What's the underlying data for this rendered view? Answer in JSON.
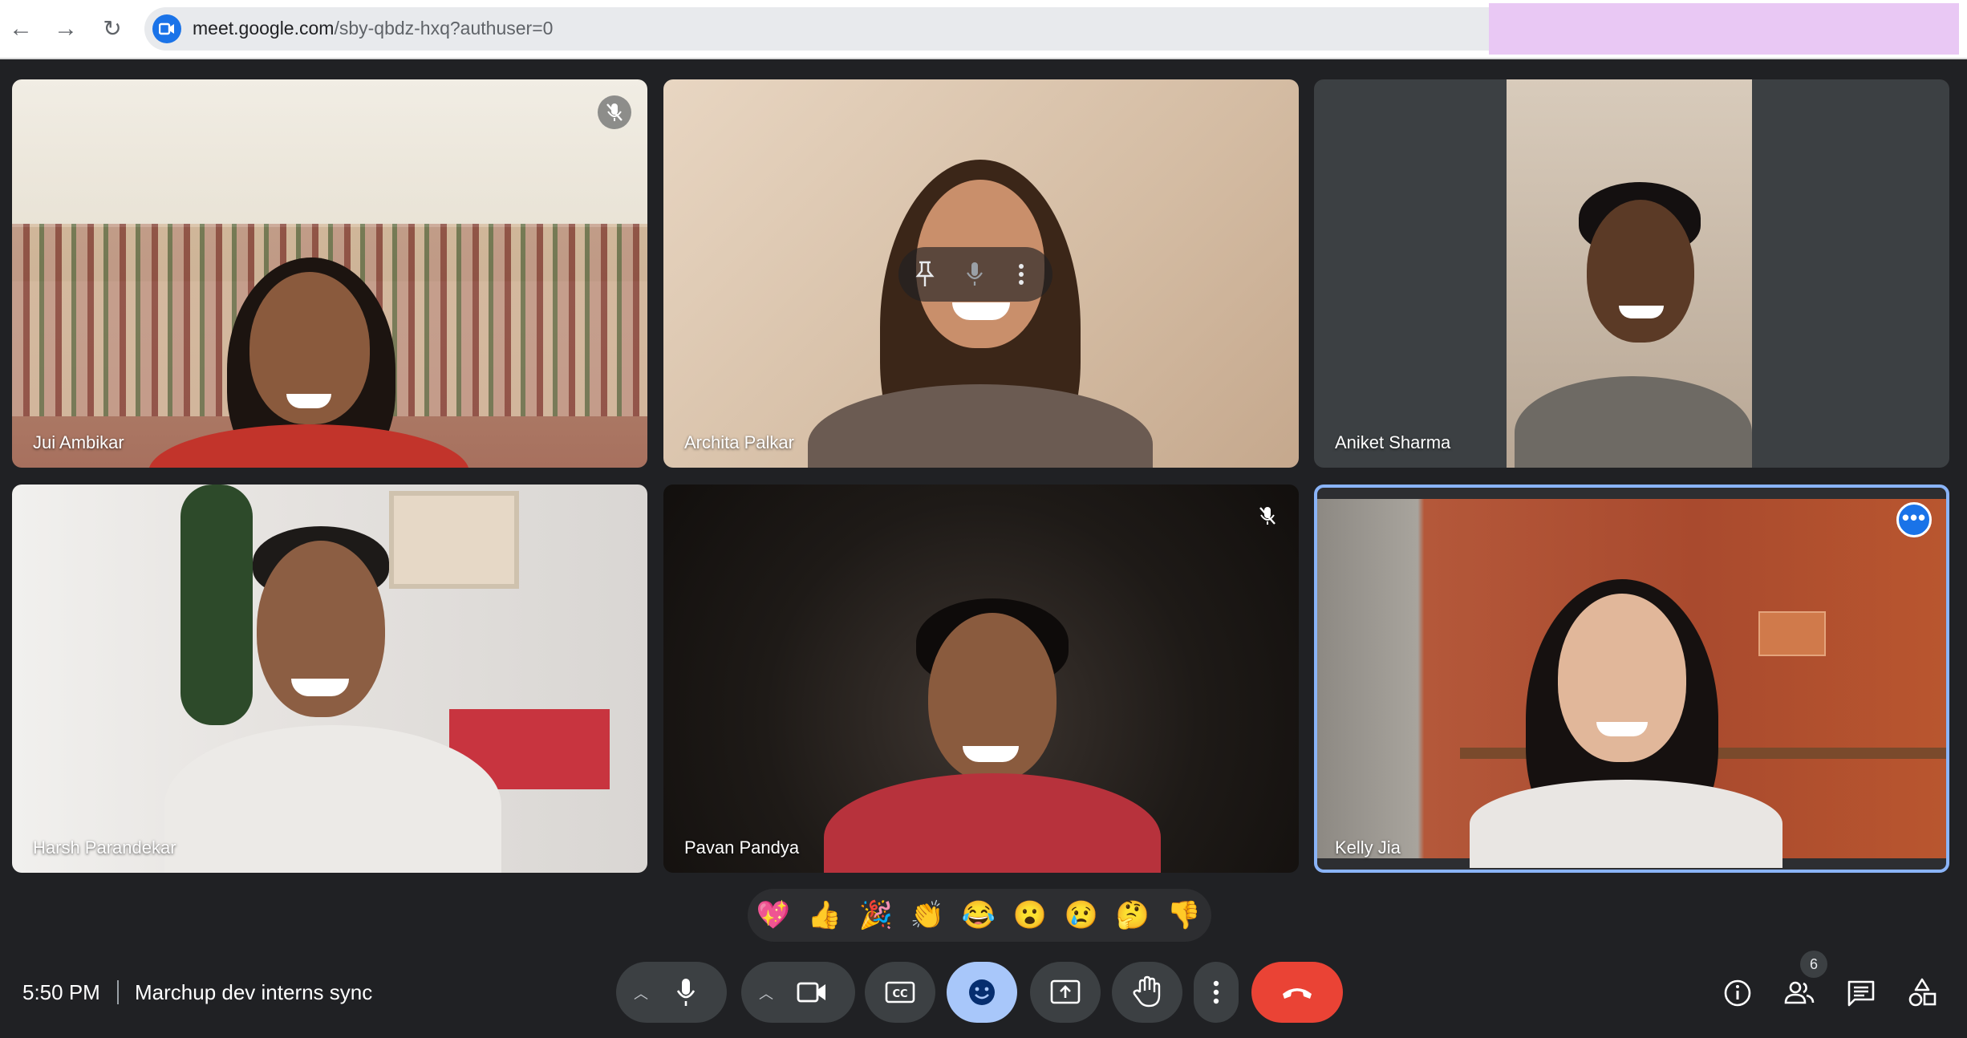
{
  "browser": {
    "url_host": "meet.google.com",
    "url_path": "/sby-qbdz-hxq?authuser=0"
  },
  "participants": [
    {
      "name": "Jui Ambikar",
      "muted": true
    },
    {
      "name": "Archita Palkar",
      "muted": false
    },
    {
      "name": "Aniket Sharma",
      "muted": false
    },
    {
      "name": "Harsh Parandekar",
      "muted": false
    },
    {
      "name": "Pavan Pandya",
      "muted": true
    },
    {
      "name": "Kelly Jia",
      "muted": false,
      "selected": true
    }
  ],
  "reactions": [
    "💖",
    "👍",
    "🎉",
    "👏",
    "😂",
    "😮",
    "😢",
    "🤔",
    "👎"
  ],
  "footer": {
    "time": "5:50 PM",
    "meeting_title": "Marchup dev interns sync",
    "people_count": "6"
  },
  "colors": {
    "background": "#202124",
    "control": "#3c4043",
    "active_control": "#a8c7fa",
    "end_call": "#ea4335",
    "selected_outline": "#8ab4f8"
  },
  "icons": [
    "back-icon",
    "forward-icon",
    "reload-icon",
    "meet-icon",
    "mic-off-icon",
    "pin-icon",
    "mic-icon",
    "more-vert-icon",
    "more-horiz-icon",
    "chevron-up-icon",
    "videocam-icon",
    "captions-icon",
    "emoji-icon",
    "present-icon",
    "raise-hand-icon",
    "call-end-icon",
    "info-icon",
    "people-icon",
    "chat-icon",
    "activities-icon"
  ]
}
